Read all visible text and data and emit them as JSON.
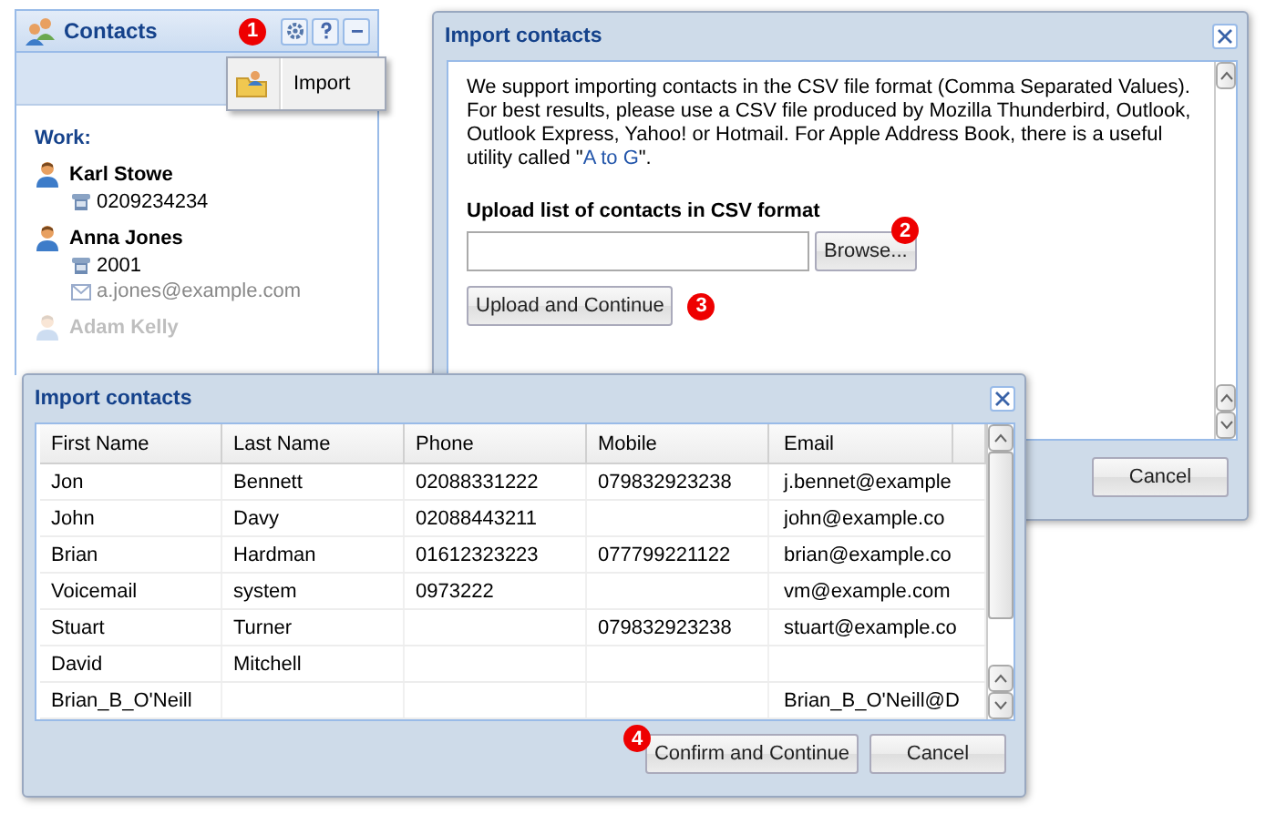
{
  "contacts_panel": {
    "title": "Contacts",
    "badge": "1",
    "menu": {
      "items": [
        {
          "label": "Import"
        }
      ]
    },
    "group": "Work:",
    "contacts": [
      {
        "name": "Karl Stowe",
        "faded": false,
        "details": [
          {
            "kind": "phone",
            "text": "0209234234"
          }
        ]
      },
      {
        "name": "Anna Jones",
        "faded": false,
        "details": [
          {
            "kind": "phone",
            "text": "2001"
          },
          {
            "kind": "email",
            "text": "a.jones@example.com"
          }
        ]
      },
      {
        "name": "Adam Kelly",
        "faded": true
      }
    ]
  },
  "upload_dialog": {
    "title": "Import contacts",
    "intro_before": "We support importing contacts in the CSV file format (Comma Separated Values). For best results, please use a CSV file produced by Mozilla Thunderbird, Outlook, Outlook Express, Yahoo! or Hotmail. For Apple Address Book, there is a useful utility called \"",
    "link": "A to G",
    "intro_after": "\".",
    "upload_label": "Upload list of contacts in CSV format",
    "browse_button": "Browse...",
    "browse_badge": "2",
    "upload_button": "Upload and Continue",
    "upload_badge": "3",
    "cancel_button": "Cancel"
  },
  "confirm_dialog": {
    "title": "Import contacts",
    "table": {
      "columns": [
        "First Name",
        "Last Name",
        "Phone",
        "Mobile",
        "Email"
      ],
      "rows": [
        [
          "Jon",
          "Bennett",
          "02088331222",
          "079832923238",
          "j.bennet@example"
        ],
        [
          "John",
          "Davy",
          "02088443211",
          "",
          "john@example.co"
        ],
        [
          "Brian",
          "Hardman",
          "01612323223",
          "077799221122",
          "brian@example.co"
        ],
        [
          "Voicemail",
          "system",
          "0973222",
          "",
          "vm@example.com"
        ],
        [
          "Stuart",
          "Turner",
          "",
          "079832923238",
          "stuart@example.co"
        ],
        [
          "David",
          "Mitchell",
          "",
          "",
          ""
        ],
        [
          "Brian_B_O'Neill",
          "",
          "",
          "",
          "Brian_B_O'Neill@D"
        ]
      ]
    },
    "confirm_badge": "4",
    "confirm_button": "Confirm and Continue",
    "cancel_button": "Cancel"
  }
}
